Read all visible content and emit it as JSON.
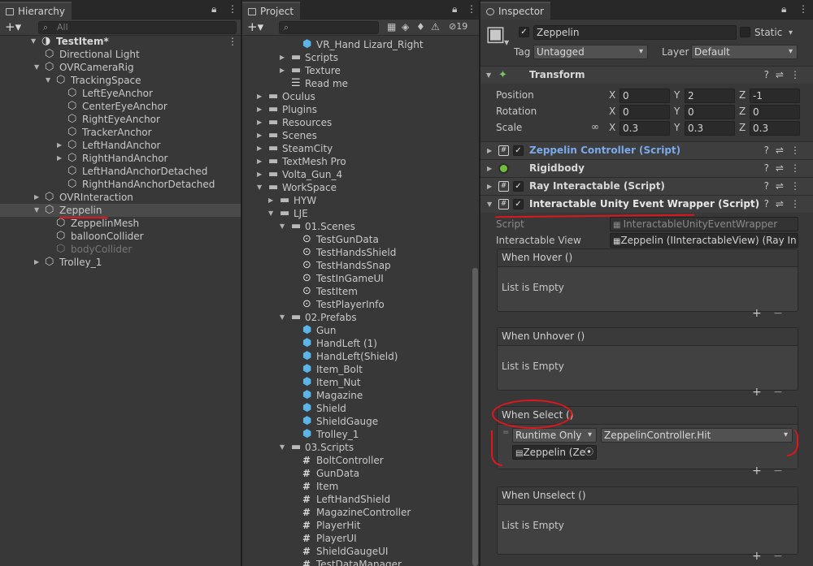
{
  "hierarchy": {
    "tab_label": "Hierarchy",
    "search_placeholder": "All",
    "scene_name": "TestItem*",
    "items": [
      {
        "label": "Directional Light"
      },
      {
        "label": "OVRCameraRig"
      },
      {
        "label": "TrackingSpace"
      },
      {
        "label": "LeftEyeAnchor"
      },
      {
        "label": "CenterEyeAnchor"
      },
      {
        "label": "RightEyeAnchor"
      },
      {
        "label": "TrackerAnchor"
      },
      {
        "label": "LeftHandAnchor"
      },
      {
        "label": "RightHandAnchor"
      },
      {
        "label": "LeftHandAnchorDetached"
      },
      {
        "label": "RightHandAnchorDetached"
      },
      {
        "label": "OVRInteraction"
      },
      {
        "label": "Zeppelin"
      },
      {
        "label": "ZeppelinMesh"
      },
      {
        "label": "balloonCollider"
      },
      {
        "label": "bodyCollider"
      },
      {
        "label": "Trolley_1"
      }
    ]
  },
  "project": {
    "tab_label": "Project",
    "hidden_count": "19",
    "items": [
      {
        "label": "VR_Hand Lizard_Right"
      },
      {
        "label": "Scripts"
      },
      {
        "label": "Texture"
      },
      {
        "label": "Read me"
      },
      {
        "label": "Oculus"
      },
      {
        "label": "Plugins"
      },
      {
        "label": "Resources"
      },
      {
        "label": "Scenes"
      },
      {
        "label": "SteamCity"
      },
      {
        "label": "TextMesh Pro"
      },
      {
        "label": "Volta_Gun_4"
      },
      {
        "label": "WorkSpace"
      },
      {
        "label": "HYW"
      },
      {
        "label": "LJE"
      },
      {
        "label": "01.Scenes"
      },
      {
        "label": "TestGunData"
      },
      {
        "label": "TestHandsShield"
      },
      {
        "label": "TestHandsSnap"
      },
      {
        "label": "TestInGameUI"
      },
      {
        "label": "TestItem"
      },
      {
        "label": "TestPlayerInfo"
      },
      {
        "label": "02.Prefabs"
      },
      {
        "label": "Gun"
      },
      {
        "label": "HandLeft (1)"
      },
      {
        "label": "HandLeft(Shield)"
      },
      {
        "label": "Item_Bolt"
      },
      {
        "label": "Item_Nut"
      },
      {
        "label": "Magazine"
      },
      {
        "label": "Shield"
      },
      {
        "label": "ShieldGauge"
      },
      {
        "label": "Trolley_1"
      },
      {
        "label": "03.Scripts"
      },
      {
        "label": "BoltController"
      },
      {
        "label": "GunData"
      },
      {
        "label": "Item"
      },
      {
        "label": "LeftHandShield"
      },
      {
        "label": "MagazineController"
      },
      {
        "label": "PlayerHit"
      },
      {
        "label": "PlayerUI"
      },
      {
        "label": "ShieldGaugeUI"
      },
      {
        "label": "TestDataManager"
      }
    ]
  },
  "inspector": {
    "tab_label": "Inspector",
    "object_name": "Zeppelin",
    "static_label": "Static",
    "tag_label": "Tag",
    "tag_value": "Untagged",
    "layer_label": "Layer",
    "layer_value": "Default",
    "transform": {
      "title": "Transform",
      "position_label": "Position",
      "rotation_label": "Rotation",
      "scale_label": "Scale",
      "x": "X",
      "y": "Y",
      "z": "Z",
      "position": [
        "0",
        "2",
        "-1"
      ],
      "rotation": [
        "0",
        "0",
        "0"
      ],
      "scale": [
        "0.3",
        "0.3",
        "0.3"
      ]
    },
    "components": [
      {
        "title": "Zeppelin Controller (Script)"
      },
      {
        "title": "Rigidbody"
      },
      {
        "title": "Ray Interactable (Script)"
      },
      {
        "title": "Interactable Unity Event Wrapper (Script)"
      }
    ],
    "script_label": "Script",
    "script_value": "InteractableUnityEventWrapper",
    "view_label": "Interactable View",
    "view_value": "Zeppelin (IInteractableView) (Ray In",
    "events": [
      {
        "title": "When Hover ()",
        "empty": "List is Empty"
      },
      {
        "title": "When Unhover ()",
        "empty": "List is Empty"
      },
      {
        "title": "When Select ()",
        "runtime": "Runtime Only",
        "method": "ZeppelinController.Hit",
        "target": "Zeppelin (Ze"
      },
      {
        "title": "When Unselect ()",
        "empty": "List is Empty"
      }
    ]
  },
  "colors": {
    "annotation": "#e0161b",
    "link": "#7aa9ec"
  }
}
